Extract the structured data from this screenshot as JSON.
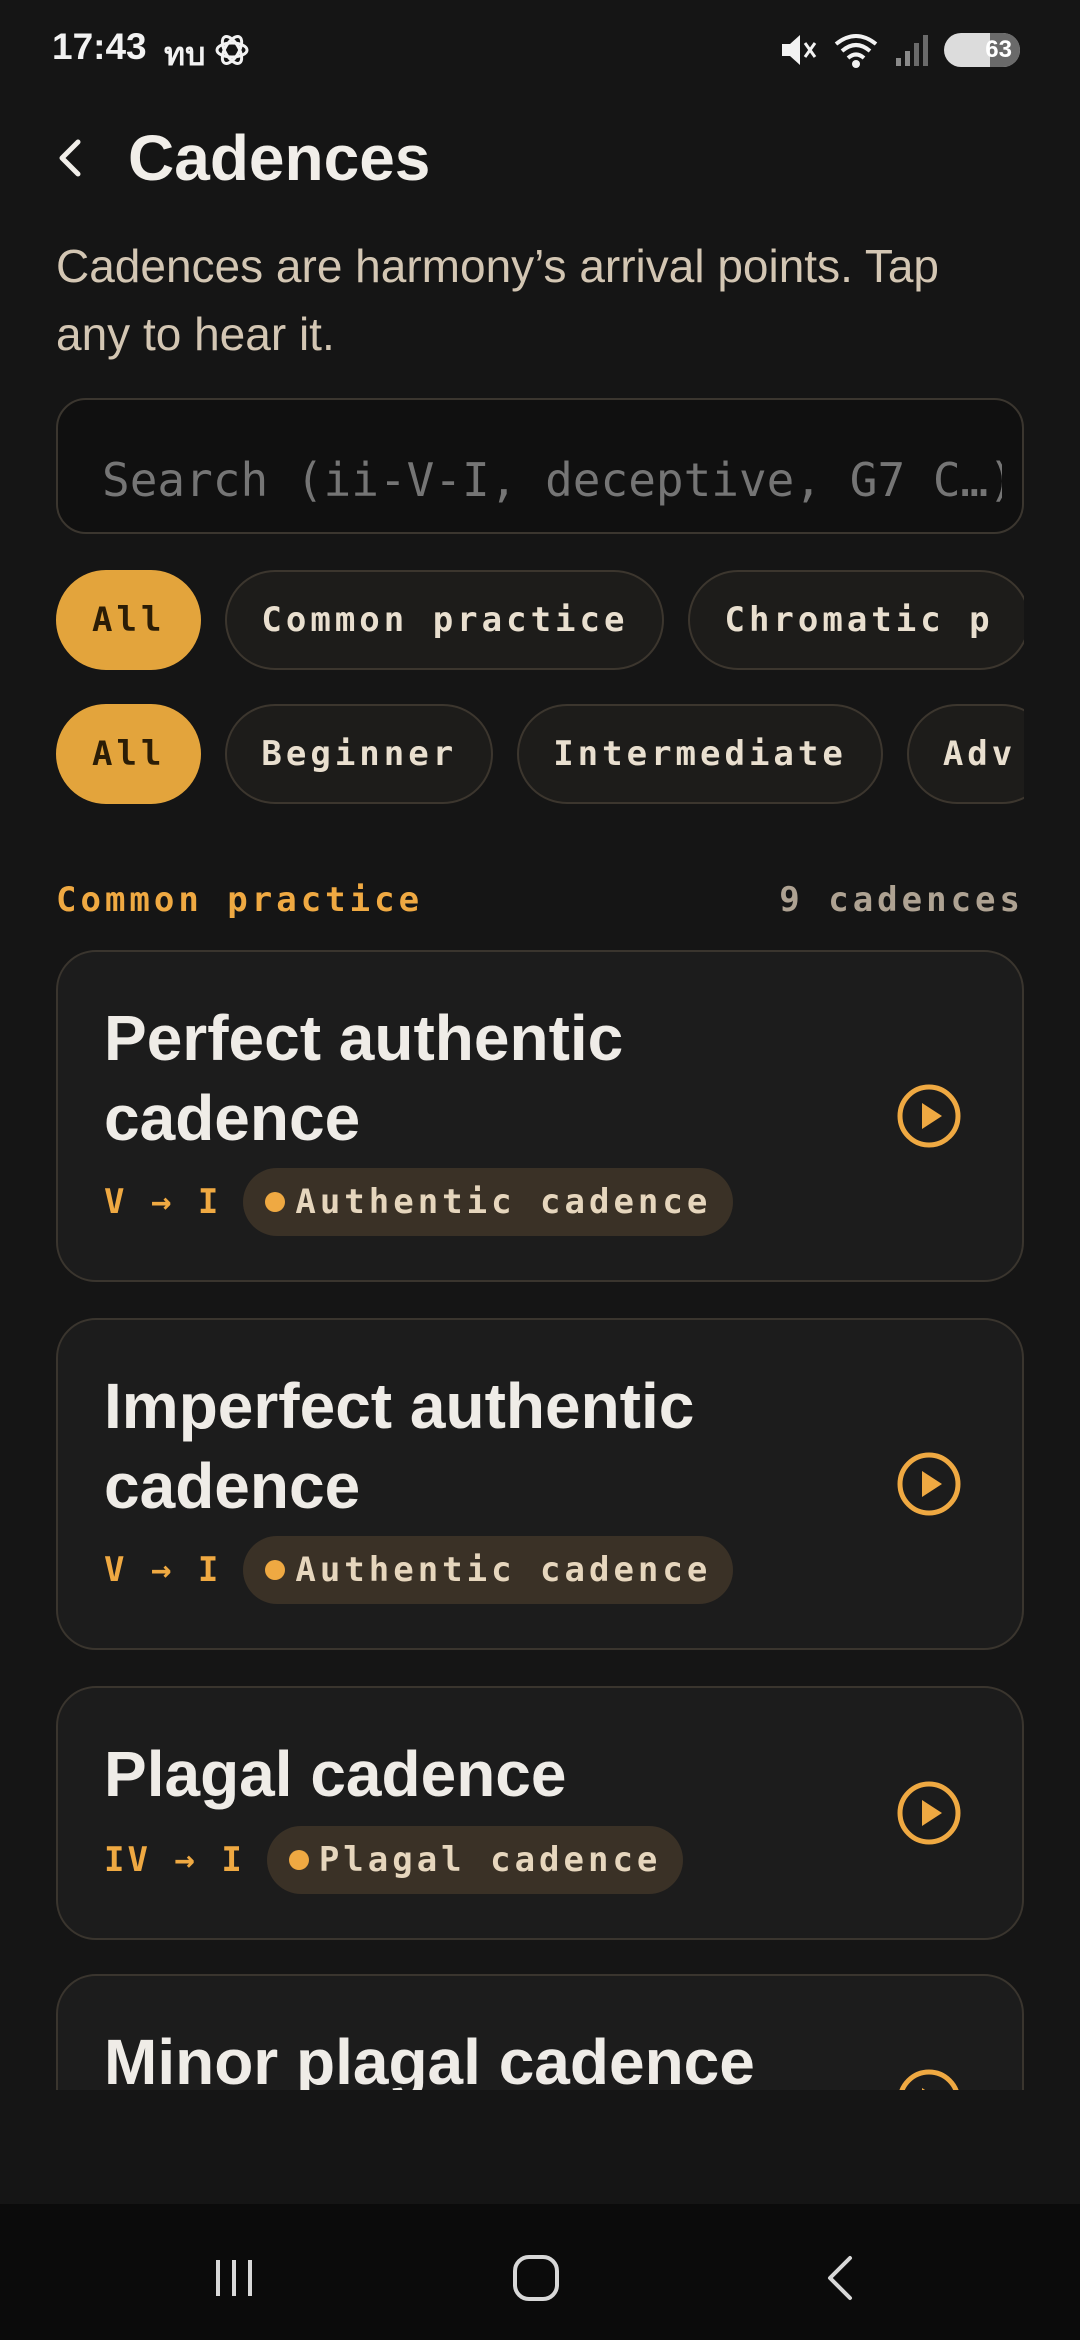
{
  "status_bar": {
    "time": "17:43",
    "carrier": "ทบ",
    "battery": "63"
  },
  "header": {
    "title": "Cadences"
  },
  "subtitle": "Cadences are harmony’s arrival points. Tap any to hear it.",
  "search": {
    "value": "",
    "placeholder": "Search (ii-V-I, deceptive, G7 C…)"
  },
  "filters": {
    "categories": [
      "All",
      "Common practice",
      "Chromatic p"
    ],
    "levels": [
      "All",
      "Beginner",
      "Intermediate",
      "Adv"
    ]
  },
  "section": {
    "title": "Common practice",
    "count": "9 cadences"
  },
  "cadences": [
    {
      "title": "Perfect authentic cadence",
      "progression": "V → I",
      "type": "Authentic cadence"
    },
    {
      "title": "Imperfect authentic cadence",
      "progression": "V → I",
      "type": "Authentic cadence"
    },
    {
      "title": "Plagal cadence",
      "progression": "IV → I",
      "type": "Plagal cadence"
    },
    {
      "title": "Minor plagal cadence",
      "progression": "",
      "type": ""
    }
  ],
  "colors": {
    "accent": "#efa942",
    "background": "#151515",
    "card": "#1c1c1c"
  }
}
